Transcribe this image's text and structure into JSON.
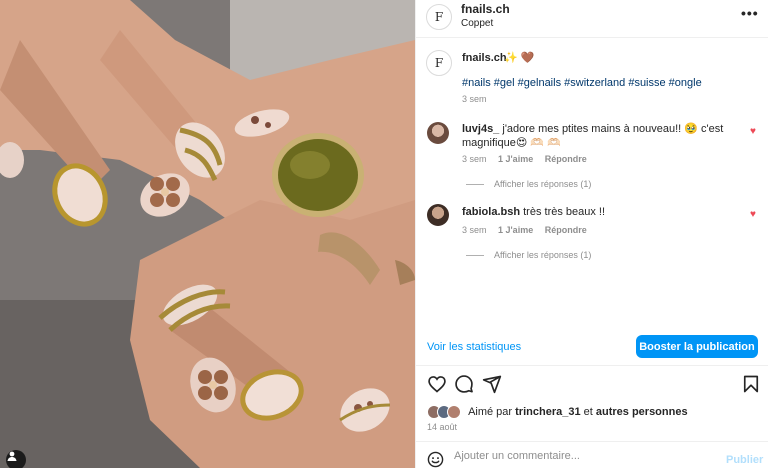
{
  "colors": {
    "accent": "#0095f6",
    "like": "#ed4956",
    "muted": "#8e8e8e",
    "hashtag": "#00376b"
  },
  "photo": {
    "alt_icon": "user-tag-icon"
  },
  "header": {
    "username": "fnails.ch",
    "location": "Coppet",
    "logo_letter": "F",
    "more_icon": "more-horizontal-icon"
  },
  "caption": {
    "username": "fnails.ch",
    "emojis": "✨ 🤎",
    "hashtags": "#nails #gel #gelnails #switzerland #suisse #ongle",
    "time": "3 sem"
  },
  "comments": [
    {
      "username": "luvj4s_",
      "text": " j'adore mes ptites mains à nouveau!! 🥹  c'est magnifique😍 🫶🏻 🫶🏻",
      "time": "3 sem",
      "likes": "1 J'aime",
      "reply": "Répondre",
      "view_replies": "Afficher les réponses (1)"
    },
    {
      "username": "fabiola.bsh",
      "text": " très très beaux !!",
      "time": "3 sem",
      "likes": "1 J'aime",
      "reply": "Répondre",
      "view_replies": "Afficher les réponses (1)"
    }
  ],
  "stats": {
    "insights_label": "Voir les statistiques",
    "boost_label": "Booster la publication"
  },
  "actions": {
    "like": "heart-icon",
    "comment": "comment-icon",
    "share": "share-icon",
    "save": "bookmark-icon"
  },
  "likes": {
    "prefix": "Aimé par ",
    "user": "trinchera_31",
    "middle": " et ",
    "others": "autres personnes"
  },
  "date": "14 août",
  "comment_box": {
    "placeholder": "Ajouter un commentaire...",
    "publish_label": "Publier"
  }
}
